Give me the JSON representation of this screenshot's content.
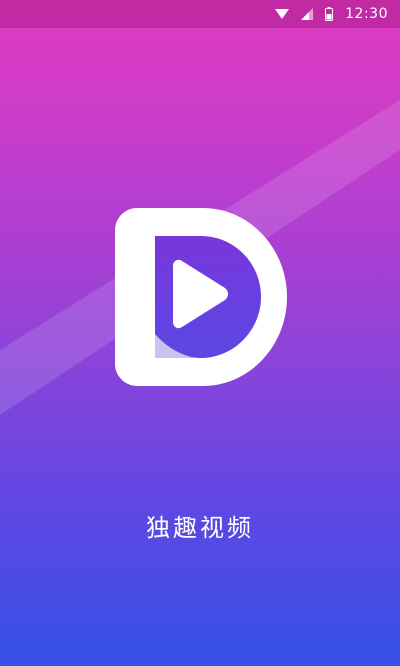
{
  "status_bar": {
    "time": "12:30",
    "icons": [
      "wifi-icon",
      "signal-icon",
      "battery-icon"
    ]
  },
  "splash": {
    "app_name": "独趣视频",
    "logo": "app-logo-d-play-icon"
  },
  "colors": {
    "gradient_top": "#e13cc0",
    "gradient_bottom": "#3651e7",
    "text": "#ffffff"
  }
}
